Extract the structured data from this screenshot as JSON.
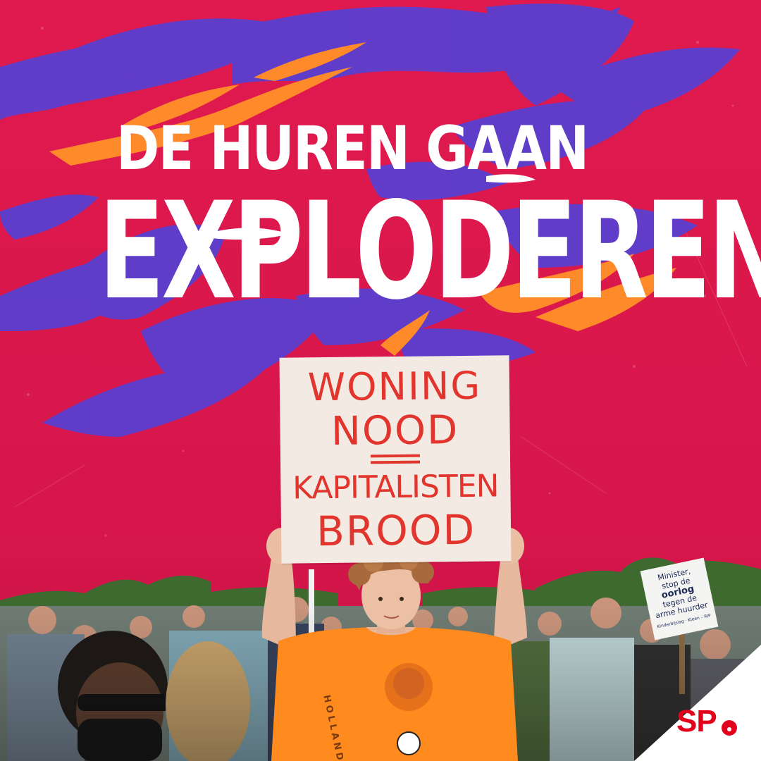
{
  "headline": {
    "line1": "DE HUREN GAAN",
    "line2": "EXPLODEREN!"
  },
  "protest_sign": {
    "lines": [
      "WONING",
      "NOOD",
      "KAPITALISTEN",
      "BROOD"
    ]
  },
  "minister_sign": {
    "lines": [
      "Minister,",
      "stop de",
      "oorlog",
      "tegen de",
      "arme huurder"
    ],
    "footer": "Kinderbijslag · Kleen – RIP"
  },
  "shirt_text": "HOLLAND",
  "logo": {
    "text": "SP"
  },
  "colors": {
    "background": "#d9164a",
    "purple_swoosh": "#5a3fd0",
    "orange_swoosh": "#ff8a2a",
    "headline_text": "#ffffff",
    "sign_paint": "#e2352e",
    "shirt": "#ff8a1e",
    "logo_red": "#e3001b"
  }
}
